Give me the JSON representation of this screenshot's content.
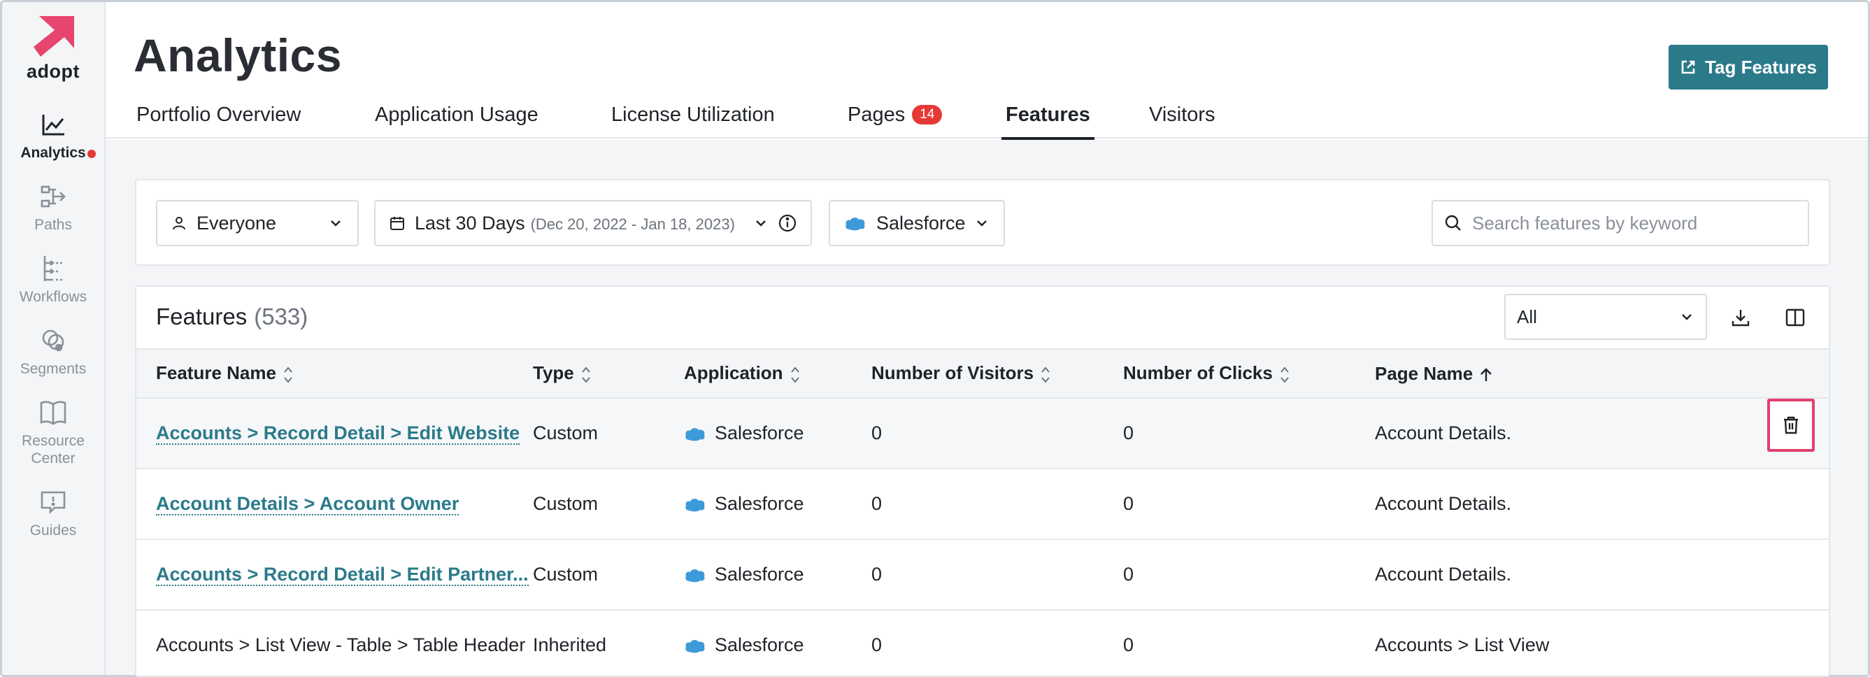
{
  "brand": {
    "name": "adopt",
    "color": "#e6456d"
  },
  "sidebar": {
    "items": [
      {
        "label": "Analytics",
        "icon": "line-chart-icon",
        "active": true,
        "dot": true
      },
      {
        "label": "Paths",
        "icon": "paths-icon"
      },
      {
        "label": "Workflows",
        "icon": "workflow-icon"
      },
      {
        "label": "Segments",
        "icon": "segments-icon"
      },
      {
        "label_line1": "Resource",
        "label_line2": "Center",
        "icon": "book-icon"
      },
      {
        "label": "Guides",
        "icon": "guide-icon"
      }
    ]
  },
  "header": {
    "title": "Analytics",
    "tag_button": "Tag Features"
  },
  "tabs": [
    {
      "label": "Portfolio Overview"
    },
    {
      "label": "Application Usage"
    },
    {
      "label": "License Utilization"
    },
    {
      "label": "Pages",
      "badge": "14"
    },
    {
      "label": "Features",
      "active": true
    },
    {
      "label": "Visitors"
    }
  ],
  "filters": {
    "audience": "Everyone",
    "date_range": "Last 30 Days",
    "date_detail": "(Dec 20, 2022 - Jan 18, 2023)",
    "application": "Salesforce",
    "search_placeholder": "Search features by keyword"
  },
  "table": {
    "title": "Features",
    "count": "(533)",
    "filter_select": "All",
    "columns": [
      "Feature Name",
      "Type",
      "Application",
      "Number of Visitors",
      "Number of Clicks",
      "Page Name"
    ],
    "rows": [
      {
        "feature": "Accounts > Record Detail > Edit Website",
        "link": true,
        "type": "Custom",
        "application": "Salesforce",
        "visitors": "0",
        "clicks": "0",
        "page": "Account Details."
      },
      {
        "feature": "Account Details > Account Owner",
        "link": true,
        "type": "Custom",
        "application": "Salesforce",
        "visitors": "0",
        "clicks": "0",
        "page": "Account Details."
      },
      {
        "feature": "Accounts > Record Detail > Edit Partner...",
        "link": true,
        "type": "Custom",
        "application": "Salesforce",
        "visitors": "0",
        "clicks": "0",
        "page": "Account Details."
      },
      {
        "feature": "Accounts > List View - Table > Table Header",
        "link": false,
        "type": "Inherited",
        "application": "Salesforce",
        "visitors": "0",
        "clicks": "0",
        "page": "Accounts > List View"
      }
    ]
  },
  "colors": {
    "accent": "#2b7a8a",
    "badge": "#e53935",
    "highlight": "#e0416d",
    "salesforce": "#3d9ad9"
  }
}
